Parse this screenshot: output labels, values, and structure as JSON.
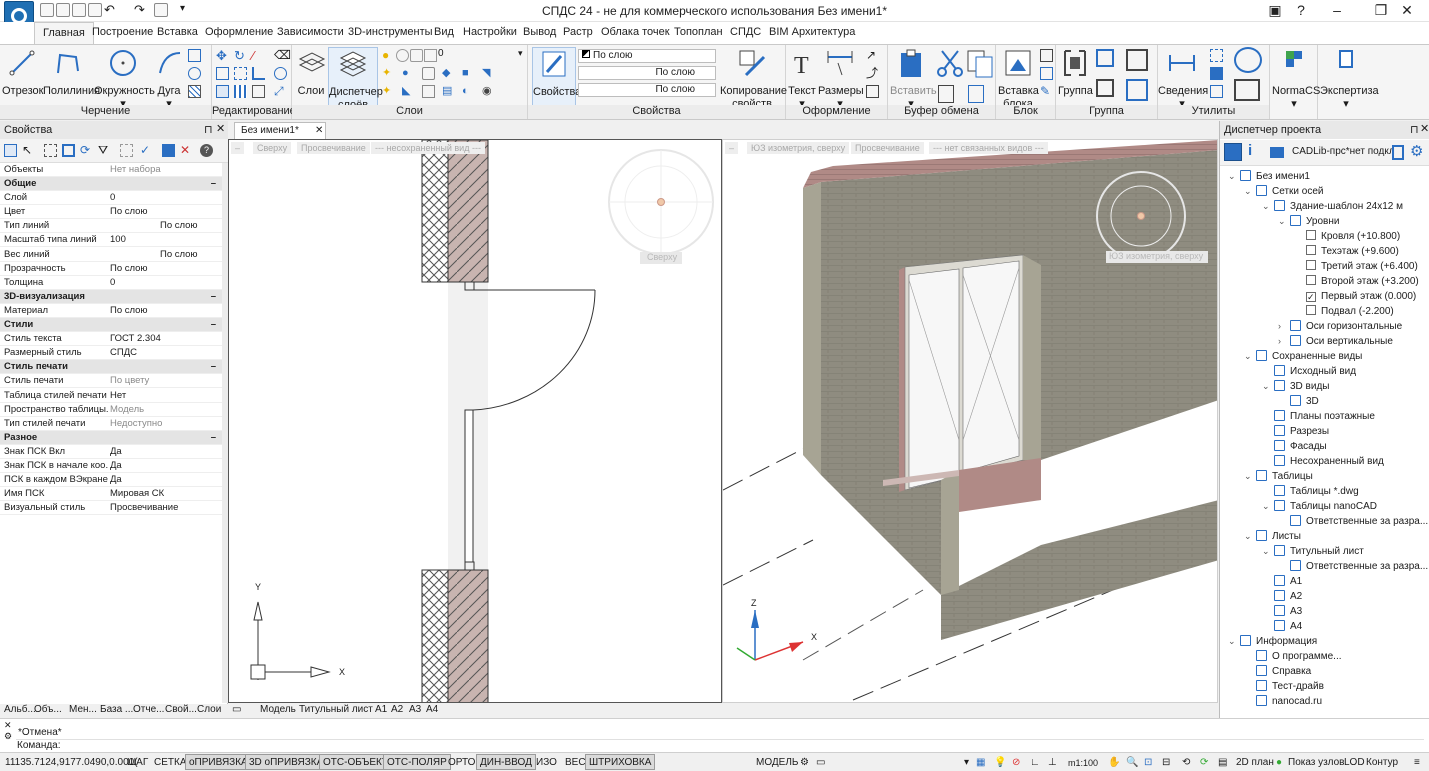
{
  "window": {
    "title": "СПДС 24 - не для коммерческого использования Без имени1*"
  },
  "ribbon_tabs": [
    "Главная",
    "Построение",
    "Вставка",
    "Оформление",
    "Зависимости",
    "3D-инструменты",
    "Вид",
    "Настройки",
    "Вывод",
    "Растр",
    "Облака точек",
    "Топоплан",
    "СПДС",
    "BIM Архитектура"
  ],
  "ribbon": {
    "draw": {
      "buttons": [
        "Отрезок",
        "Полилиния",
        "Окружность",
        "Дуга"
      ],
      "label": "Черчение"
    },
    "edit": {
      "label": "Редактирование"
    },
    "layers": {
      "buttons": [
        "Слои",
        "Диспетчер слоёв"
      ],
      "label": "Слои",
      "layer_value": "0"
    },
    "props": {
      "button": "Свойства",
      "by_layer": "По слою",
      "line_by_layer": "По слою",
      "weight_by_layer": "По слою",
      "copy": "Копирование свойств",
      "label": "Свойства"
    },
    "annot": {
      "buttons": [
        "Текст",
        "Размеры"
      ],
      "label": "Оформление"
    },
    "clip": {
      "buttons": [
        "Вставить"
      ],
      "label": "Буфер обмена"
    },
    "block": {
      "buttons": [
        "Вставка блока"
      ],
      "label": "Блок"
    },
    "group": {
      "buttons": [
        "Группа"
      ],
      "label": "Группа"
    },
    "utils": {
      "buttons": [
        "Сведения"
      ],
      "label": "Утилиты"
    },
    "extra": {
      "buttons": [
        "NormaCS",
        "Экспертиза"
      ]
    }
  },
  "properties_panel": {
    "title": "Свойства",
    "objects": {
      "key": "Объекты",
      "value": "Нет набора"
    },
    "rows": [
      {
        "cat": "Общие"
      },
      {
        "k": "Слой",
        "v": "0"
      },
      {
        "k": "Цвет",
        "v": "По слою"
      },
      {
        "k": "Тип линий",
        "v": "По слою"
      },
      {
        "k": "Масштаб типа линий",
        "v": "100"
      },
      {
        "k": "Вес линий",
        "v": "По слою"
      },
      {
        "k": "Прозрачность",
        "v": "По слою"
      },
      {
        "k": "Толщина",
        "v": "0"
      },
      {
        "cat": "3D-визуализация"
      },
      {
        "k": "Материал",
        "v": "По слою"
      },
      {
        "cat": "Стили"
      },
      {
        "k": "Стиль текста",
        "v": "ГОСТ 2.304"
      },
      {
        "k": "Размерный стиль",
        "v": "СПДС"
      },
      {
        "cat": "Стиль печати"
      },
      {
        "k": "Стиль печати",
        "v": "По цвету",
        "grey": true
      },
      {
        "k": "Таблица стилей печати",
        "v": "Нет"
      },
      {
        "k": "Пространство таблицы...",
        "v": "Модель",
        "grey": true
      },
      {
        "k": "Тип стилей печати",
        "v": "Недоступно",
        "grey": true
      },
      {
        "cat": "Разное"
      },
      {
        "k": "Знак ПСК Вкл",
        "v": "Да"
      },
      {
        "k": "Знак ПСК в начале коо...",
        "v": "Да"
      },
      {
        "k": "ПСК в каждом ВЭкране",
        "v": "Да"
      },
      {
        "k": "Имя ПСК",
        "v": "Мировая СК"
      },
      {
        "k": "Визуальный стиль",
        "v": "Просвечивание"
      }
    ],
    "bottom_tabs": [
      "Альб...",
      "Объ...",
      "Мен...",
      "База ...",
      "Отче...",
      "Свой...",
      "Слои"
    ]
  },
  "doc_tab": "Без имени1*",
  "viewport_left": {
    "header": [
      "–",
      "Сверху",
      "Просвечивание",
      "--- несохраненный вид ---"
    ],
    "cube_label": "Сверху",
    "ucs": {
      "x": "X",
      "y": "Y"
    }
  },
  "viewport_right": {
    "header": [
      "–",
      "ЮЗ изометрия, сверху",
      "Просвечивание",
      "--- нет связанных видов ---"
    ],
    "cube_label": "ЮЗ изометрия, сверху",
    "ucs": {
      "x": "X",
      "z": "Z"
    }
  },
  "sheet_tabs": [
    "Модель",
    "Титульный лист",
    "A1",
    "A2",
    "A3",
    "A4"
  ],
  "project_manager": {
    "title": "Диспетчер проекта",
    "profile": "CADLib-прс*нет подкл",
    "tree": [
      {
        "t": "Без имени1",
        "lvl": 0,
        "arrow": "v"
      },
      {
        "t": "Сетки осей",
        "lvl": 1,
        "arrow": "v"
      },
      {
        "t": "Здание-шаблон 24x12 м",
        "lvl": 2,
        "arrow": "v"
      },
      {
        "t": "Уровни",
        "lvl": 3,
        "arrow": "v"
      },
      {
        "t": "Кровля (+10.800)",
        "lvl": 4,
        "check": false
      },
      {
        "t": "Техэтаж (+9.600)",
        "lvl": 4,
        "check": false
      },
      {
        "t": "Третий этаж (+6.400)",
        "lvl": 4,
        "check": false
      },
      {
        "t": "Второй этаж (+3.200)",
        "lvl": 4,
        "check": false
      },
      {
        "t": "Первый этаж (0.000)",
        "lvl": 4,
        "check": true
      },
      {
        "t": "Подвал (-2.200)",
        "lvl": 4,
        "check": false
      },
      {
        "t": "Оси горизонтальные",
        "lvl": 3,
        "arrow": ">"
      },
      {
        "t": "Оси вертикальные",
        "lvl": 3,
        "arrow": ">"
      },
      {
        "t": "Сохраненные виды",
        "lvl": 1,
        "arrow": "v"
      },
      {
        "t": "Исходный вид",
        "lvl": 2
      },
      {
        "t": "3D виды",
        "lvl": 2,
        "arrow": "v"
      },
      {
        "t": "3D",
        "lvl": 3
      },
      {
        "t": "Планы поэтажные",
        "lvl": 2
      },
      {
        "t": "Разрезы",
        "lvl": 2
      },
      {
        "t": "Фасады",
        "lvl": 2
      },
      {
        "t": "Несохраненный вид",
        "lvl": 2
      },
      {
        "t": "Таблицы",
        "lvl": 1,
        "arrow": "v"
      },
      {
        "t": "Таблицы *.dwg",
        "lvl": 2
      },
      {
        "t": "Таблицы nanoCAD",
        "lvl": 2,
        "arrow": "v"
      },
      {
        "t": "Ответственные за разра...",
        "lvl": 3
      },
      {
        "t": "Листы",
        "lvl": 1,
        "arrow": "v"
      },
      {
        "t": "Титульный лист",
        "lvl": 2,
        "arrow": "v"
      },
      {
        "t": "Ответственные за разра...",
        "lvl": 3
      },
      {
        "t": "A1",
        "lvl": 2
      },
      {
        "t": "A2",
        "lvl": 2
      },
      {
        "t": "A3",
        "lvl": 2
      },
      {
        "t": "A4",
        "lvl": 2
      },
      {
        "t": "Информация",
        "lvl": 0,
        "arrow": "v"
      },
      {
        "t": "О программе...",
        "lvl": 1
      },
      {
        "t": "Справка",
        "lvl": 1
      },
      {
        "t": "Тест-драйв",
        "lvl": 1
      },
      {
        "t": "nanocad.ru",
        "lvl": 1
      }
    ]
  },
  "command": {
    "history": "*Отмена*",
    "prompt": "Команда:"
  },
  "status": {
    "coords": "11135.7124,9177.0490,0.000(",
    "toggles": [
      {
        "t": "ШАГ",
        "on": false
      },
      {
        "t": "СЕТКА",
        "on": false
      },
      {
        "t": "оПРИВЯЗКА",
        "on": true
      },
      {
        "t": "3D оПРИВЯЗКА",
        "on": true
      },
      {
        "t": "ОТС-ОБЪЕКТ",
        "on": true
      },
      {
        "t": "ОТС-ПОЛЯР",
        "on": true
      },
      {
        "t": "ОРТО",
        "on": false
      },
      {
        "t": "ДИН-ВВОД",
        "on": true
      },
      {
        "t": "ИЗО",
        "on": false
      },
      {
        "t": "ВЕС",
        "on": false
      },
      {
        "t": "ШТРИХОВКА",
        "on": true
      }
    ],
    "model": "МОДЕЛЬ",
    "scale": "m1:100",
    "right": [
      "2D план",
      "Показ узлов",
      "LOD",
      "Контур"
    ]
  },
  "colors": {
    "accent": "#2a6ec2",
    "wall_fill": "#c8b4b0",
    "wall3d": "#8c8a7a"
  }
}
